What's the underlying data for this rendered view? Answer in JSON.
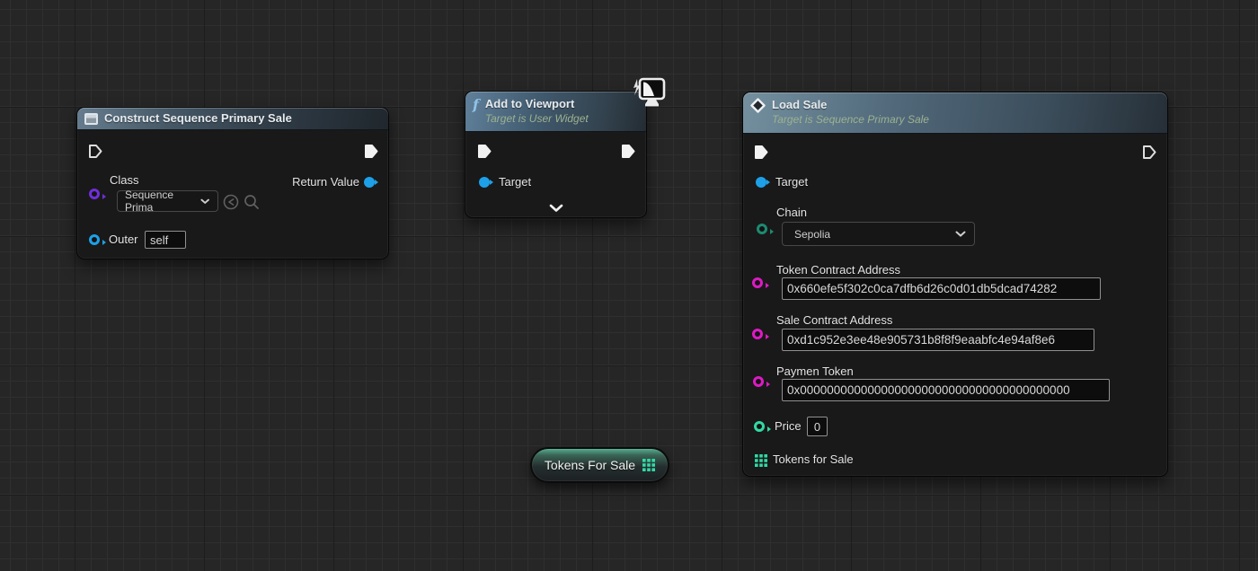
{
  "construct_node": {
    "title": "Construct Sequence Primary Sale",
    "class_pin_label": "Class",
    "class_dropdown_value": "Sequence Prima",
    "return_pin_label": "Return Value",
    "outer_pin_label": "Outer",
    "outer_field_value": "self"
  },
  "viewport_node": {
    "title": "Add to Viewport",
    "subtitle": "Target is User Widget",
    "target_pin_label": "Target"
  },
  "load_sale_node": {
    "title": "Load Sale",
    "subtitle": "Target is Sequence Primary Sale",
    "target_pin_label": "Target",
    "chain_pin_label": "Chain",
    "chain_dropdown_value": "Sepolia",
    "token_contract_label": "Token Contract Address",
    "token_contract_value": "0x660efe5f302c0ca7dfb6d26c0d01db5dcad74282",
    "sale_contract_label": "Sale Contract Address",
    "sale_contract_value": "0xd1c952e3ee48e905731b8f8f9eaabfc4e94af8e6",
    "payment_token_label": "Paymen Token",
    "payment_token_value": "0x0000000000000000000000000000000000000000",
    "price_label": "Price",
    "price_value": "0",
    "tokens_for_sale_label": "Tokens for Sale"
  },
  "variable_node": {
    "label": "Tokens For Sale"
  },
  "colors": {
    "exec_wire": "#efefef",
    "object_wire": "#1e9ce0",
    "array_wire": "#2ed9a2",
    "object_pin": "#1ea0e8",
    "class_pin": "#6f2fd8",
    "string_pin": "#dd1ac4",
    "enum_pin": "#1d8a70",
    "int_pin": "#32d9a5"
  }
}
